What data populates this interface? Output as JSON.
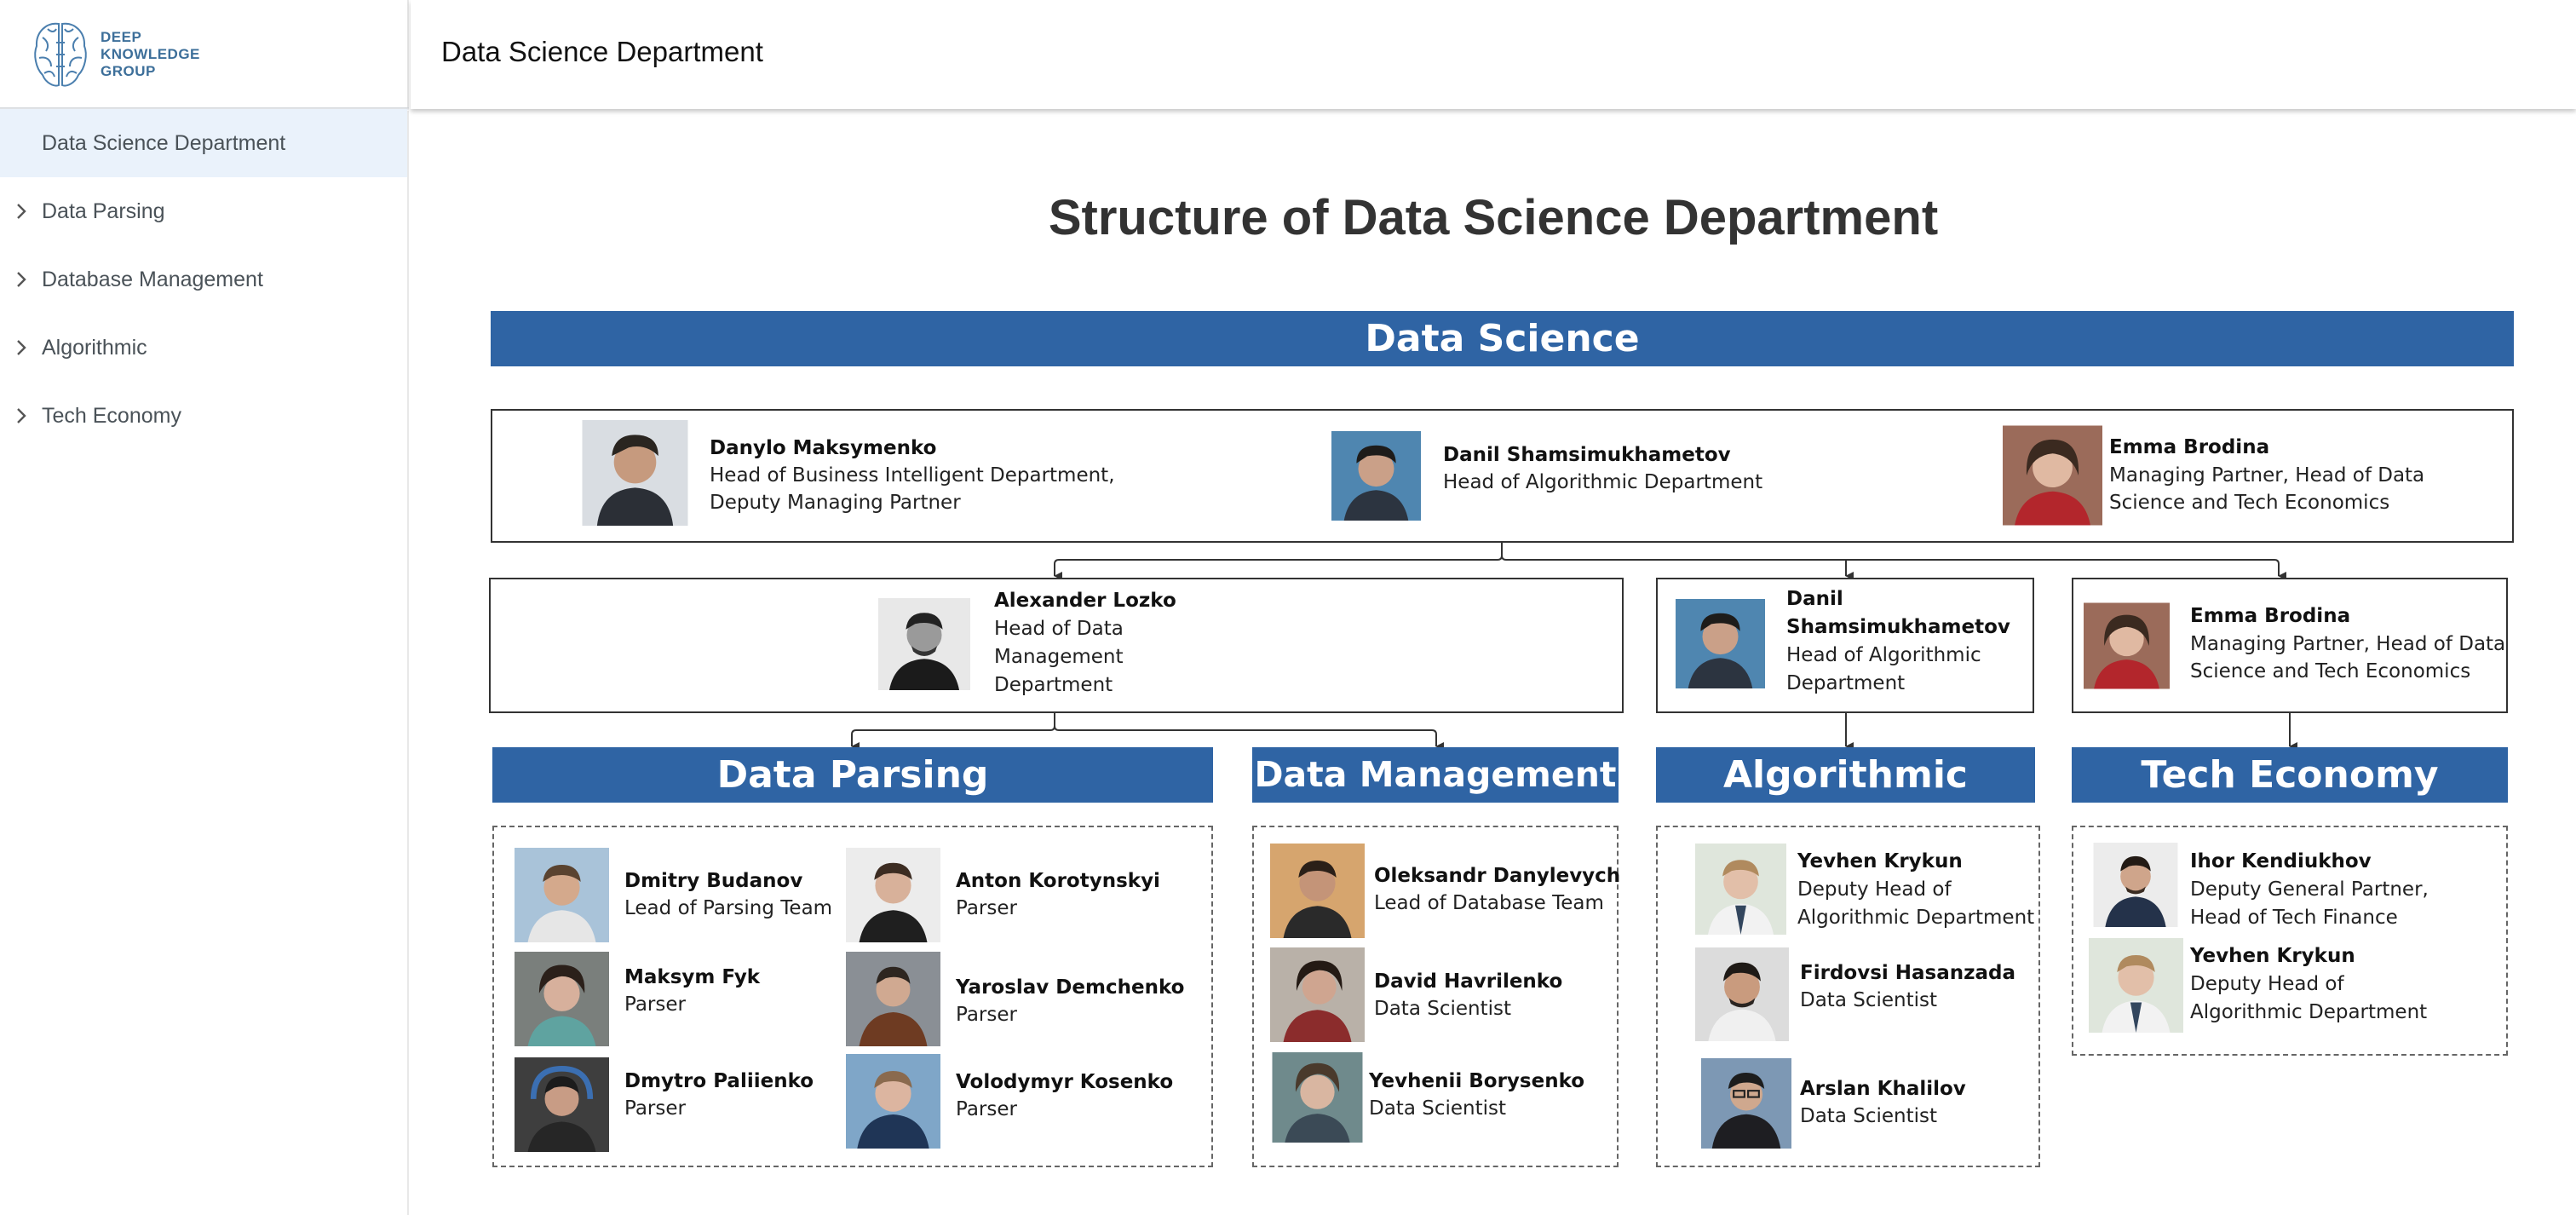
{
  "logo": {
    "lines": [
      "DEEP",
      "KNOWLEDGE",
      "GROUP"
    ]
  },
  "header": {
    "title": "Data Science Department"
  },
  "sidebar": {
    "items": [
      {
        "label": "Data Science Department",
        "active": true,
        "chevron": false
      },
      {
        "label": "Data Parsing",
        "active": false,
        "chevron": true
      },
      {
        "label": "Database Management",
        "active": false,
        "chevron": true
      },
      {
        "label": "Algorithmic",
        "active": false,
        "chevron": true
      },
      {
        "label": "Tech Economy",
        "active": false,
        "chevron": true
      }
    ]
  },
  "main": {
    "title": "Structure of Data Science Department",
    "banner": "Data Science",
    "leaders": [
      {
        "name": "Danylo Maksymenko",
        "role_lines": [
          "Head of Business Intelligent Department,",
          "Deputy Managing Partner"
        ]
      },
      {
        "name": "Danil Shamsimukhametov",
        "role_lines": [
          "Head of Algorithmic Department"
        ]
      },
      {
        "name": "Emma Brodina",
        "role_lines": [
          "Managing Partner, Head of Data",
          "Science and Tech Economics"
        ]
      }
    ],
    "heads": [
      {
        "name_lines": [
          "Alexander Lozko"
        ],
        "role_lines": [
          "Head of Data",
          "Management",
          "Department"
        ]
      },
      {
        "name_lines": [
          "Danil",
          "Shamsimukhametov"
        ],
        "role_lines": [
          "Head of Algorithmic",
          "Department"
        ]
      },
      {
        "name_lines": [
          "Emma Brodina"
        ],
        "role_lines": [
          "Managing Partner, Head of Data",
          "Science and Tech Economics"
        ]
      }
    ],
    "sections": [
      {
        "title": "Data Parsing"
      },
      {
        "title": "Data Management"
      },
      {
        "title": "Algorithmic"
      },
      {
        "title": "Tech Economy"
      }
    ],
    "data_parsing_members": [
      {
        "name": "Dmitry Budanov",
        "role": "Lead of Parsing Team"
      },
      {
        "name": "Anton Korotynskyi",
        "role": "Parser"
      },
      {
        "name": "Maksym Fyk",
        "role": "Parser"
      },
      {
        "name": "Yaroslav Demchenko",
        "role": "Parser"
      },
      {
        "name": "Dmytro Paliienko",
        "role": "Parser"
      },
      {
        "name": "Volodymyr Kosenko",
        "role": "Parser"
      }
    ],
    "data_management_members": [
      {
        "name": "Oleksandr Danylevych",
        "role": "Lead of Database Team"
      },
      {
        "name": "David Havrilenko",
        "role": "Data Scientist"
      },
      {
        "name": "Yevhenii Borysenko",
        "role": "Data Scientist"
      }
    ],
    "algorithmic_members": [
      {
        "name": "Yevhen Krykun",
        "role_lines": [
          "Deputy Head of",
          "Algorithmic Department"
        ]
      },
      {
        "name": "Firdovsi Hasanzada",
        "role_lines": [
          "Data Scientist"
        ]
      },
      {
        "name": "Arslan Khalilov",
        "role_lines": [
          "Data Scientist"
        ]
      }
    ],
    "tech_economy_members": [
      {
        "name": "Ihor Kendiukhov",
        "role_lines": [
          "Deputy General Partner,",
          "Head of Tech Finance"
        ]
      },
      {
        "name": "Yevhen Krykun",
        "role_lines": [
          "Deputy Head of",
          "Algorithmic Department"
        ]
      }
    ]
  },
  "colors": {
    "banner": "#2f64a4",
    "active_item_bg": "#eaf2fb",
    "logo": "#3d6f9a"
  }
}
